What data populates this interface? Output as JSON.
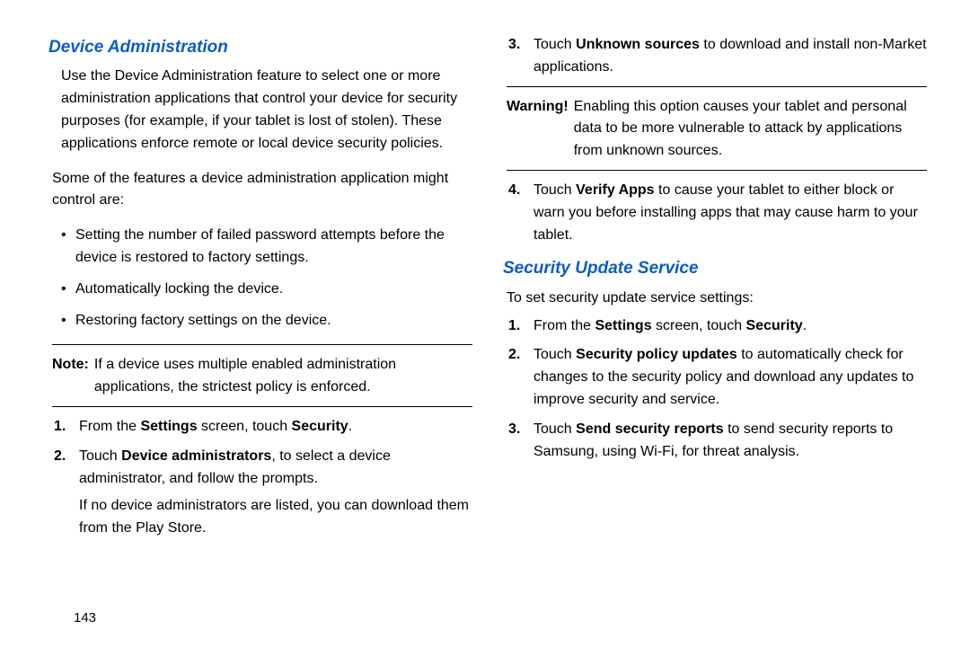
{
  "pageNumber": "143",
  "left": {
    "heading": "Device Administration",
    "intro": "Use the Device Administration feature to select one or more administration applications that control your device for security purposes (for example, if your tablet is lost of stolen). These applications enforce remote or local device security policies.",
    "featuresLead": "Some of the features a device administration application might control are:",
    "bullets": [
      "Setting the number of failed password attempts before the device is restored to factory settings.",
      "Automatically locking the device.",
      "Restoring factory settings on the device."
    ],
    "noteLabel": "Note:",
    "noteBody": "If a device uses multiple enabled administration applications, the strictest policy is enforced.",
    "steps": {
      "s1_num": "1.",
      "s1_a": "From the ",
      "s1_b": "Settings",
      "s1_c": " screen, touch ",
      "s1_d": "Security",
      "s1_e": ".",
      "s2_num": "2.",
      "s2_a": "Touch ",
      "s2_b": "Device administrators",
      "s2_c": ", to select a device administrator, and follow the prompts.",
      "s2_sub": "If no device administrators are listed, you can download them from the Play Store."
    }
  },
  "right": {
    "step3": {
      "num": "3.",
      "a": "Touch ",
      "b": "Unknown sources",
      "c": " to download and install non-Market applications."
    },
    "warnLabel": "Warning!",
    "warnBody": "Enabling this option causes your tablet and personal data to be more vulnerable to attack by applications from unknown sources.",
    "step4": {
      "num": "4.",
      "a": "Touch ",
      "b": "Verify Apps",
      "c": " to cause your tablet to either block or warn you before installing apps that may cause harm to your tablet."
    },
    "heading2": "Security Update Service",
    "lead2": "To set security update service settings:",
    "sus": {
      "s1_num": "1.",
      "s1_a": "From the ",
      "s1_b": "Settings",
      "s1_c": " screen, touch ",
      "s1_d": "Security",
      "s1_e": ".",
      "s2_num": "2.",
      "s2_a": "Touch ",
      "s2_b": "Security policy updates",
      "s2_c": " to automatically check for changes to the security policy and download any updates to improve security and service.",
      "s3_num": "3.",
      "s3_a": "Touch ",
      "s3_b": "Send security reports",
      "s3_c": " to send security reports to Samsung, using Wi-Fi, for threat analysis."
    }
  }
}
